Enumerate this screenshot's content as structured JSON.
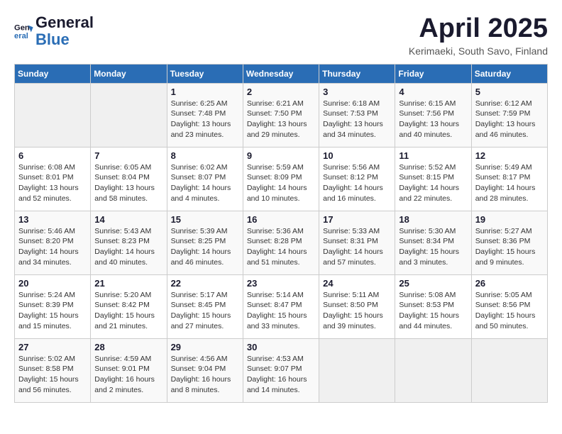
{
  "logo": {
    "line1": "General",
    "line2": "Blue"
  },
  "title": "April 2025",
  "subtitle": "Kerimaeki, South Savo, Finland",
  "days_of_week": [
    "Sunday",
    "Monday",
    "Tuesday",
    "Wednesday",
    "Thursday",
    "Friday",
    "Saturday"
  ],
  "weeks": [
    [
      {
        "day": "",
        "info": ""
      },
      {
        "day": "",
        "info": ""
      },
      {
        "day": "1",
        "info": "Sunrise: 6:25 AM\nSunset: 7:48 PM\nDaylight: 13 hours\nand 23 minutes."
      },
      {
        "day": "2",
        "info": "Sunrise: 6:21 AM\nSunset: 7:50 PM\nDaylight: 13 hours\nand 29 minutes."
      },
      {
        "day": "3",
        "info": "Sunrise: 6:18 AM\nSunset: 7:53 PM\nDaylight: 13 hours\nand 34 minutes."
      },
      {
        "day": "4",
        "info": "Sunrise: 6:15 AM\nSunset: 7:56 PM\nDaylight: 13 hours\nand 40 minutes."
      },
      {
        "day": "5",
        "info": "Sunrise: 6:12 AM\nSunset: 7:59 PM\nDaylight: 13 hours\nand 46 minutes."
      }
    ],
    [
      {
        "day": "6",
        "info": "Sunrise: 6:08 AM\nSunset: 8:01 PM\nDaylight: 13 hours\nand 52 minutes."
      },
      {
        "day": "7",
        "info": "Sunrise: 6:05 AM\nSunset: 8:04 PM\nDaylight: 13 hours\nand 58 minutes."
      },
      {
        "day": "8",
        "info": "Sunrise: 6:02 AM\nSunset: 8:07 PM\nDaylight: 14 hours\nand 4 minutes."
      },
      {
        "day": "9",
        "info": "Sunrise: 5:59 AM\nSunset: 8:09 PM\nDaylight: 14 hours\nand 10 minutes."
      },
      {
        "day": "10",
        "info": "Sunrise: 5:56 AM\nSunset: 8:12 PM\nDaylight: 14 hours\nand 16 minutes."
      },
      {
        "day": "11",
        "info": "Sunrise: 5:52 AM\nSunset: 8:15 PM\nDaylight: 14 hours\nand 22 minutes."
      },
      {
        "day": "12",
        "info": "Sunrise: 5:49 AM\nSunset: 8:17 PM\nDaylight: 14 hours\nand 28 minutes."
      }
    ],
    [
      {
        "day": "13",
        "info": "Sunrise: 5:46 AM\nSunset: 8:20 PM\nDaylight: 14 hours\nand 34 minutes."
      },
      {
        "day": "14",
        "info": "Sunrise: 5:43 AM\nSunset: 8:23 PM\nDaylight: 14 hours\nand 40 minutes."
      },
      {
        "day": "15",
        "info": "Sunrise: 5:39 AM\nSunset: 8:25 PM\nDaylight: 14 hours\nand 46 minutes."
      },
      {
        "day": "16",
        "info": "Sunrise: 5:36 AM\nSunset: 8:28 PM\nDaylight: 14 hours\nand 51 minutes."
      },
      {
        "day": "17",
        "info": "Sunrise: 5:33 AM\nSunset: 8:31 PM\nDaylight: 14 hours\nand 57 minutes."
      },
      {
        "day": "18",
        "info": "Sunrise: 5:30 AM\nSunset: 8:34 PM\nDaylight: 15 hours\nand 3 minutes."
      },
      {
        "day": "19",
        "info": "Sunrise: 5:27 AM\nSunset: 8:36 PM\nDaylight: 15 hours\nand 9 minutes."
      }
    ],
    [
      {
        "day": "20",
        "info": "Sunrise: 5:24 AM\nSunset: 8:39 PM\nDaylight: 15 hours\nand 15 minutes."
      },
      {
        "day": "21",
        "info": "Sunrise: 5:20 AM\nSunset: 8:42 PM\nDaylight: 15 hours\nand 21 minutes."
      },
      {
        "day": "22",
        "info": "Sunrise: 5:17 AM\nSunset: 8:45 PM\nDaylight: 15 hours\nand 27 minutes."
      },
      {
        "day": "23",
        "info": "Sunrise: 5:14 AM\nSunset: 8:47 PM\nDaylight: 15 hours\nand 33 minutes."
      },
      {
        "day": "24",
        "info": "Sunrise: 5:11 AM\nSunset: 8:50 PM\nDaylight: 15 hours\nand 39 minutes."
      },
      {
        "day": "25",
        "info": "Sunrise: 5:08 AM\nSunset: 8:53 PM\nDaylight: 15 hours\nand 44 minutes."
      },
      {
        "day": "26",
        "info": "Sunrise: 5:05 AM\nSunset: 8:56 PM\nDaylight: 15 hours\nand 50 minutes."
      }
    ],
    [
      {
        "day": "27",
        "info": "Sunrise: 5:02 AM\nSunset: 8:58 PM\nDaylight: 15 hours\nand 56 minutes."
      },
      {
        "day": "28",
        "info": "Sunrise: 4:59 AM\nSunset: 9:01 PM\nDaylight: 16 hours\nand 2 minutes."
      },
      {
        "day": "29",
        "info": "Sunrise: 4:56 AM\nSunset: 9:04 PM\nDaylight: 16 hours\nand 8 minutes."
      },
      {
        "day": "30",
        "info": "Sunrise: 4:53 AM\nSunset: 9:07 PM\nDaylight: 16 hours\nand 14 minutes."
      },
      {
        "day": "",
        "info": ""
      },
      {
        "day": "",
        "info": ""
      },
      {
        "day": "",
        "info": ""
      }
    ]
  ]
}
